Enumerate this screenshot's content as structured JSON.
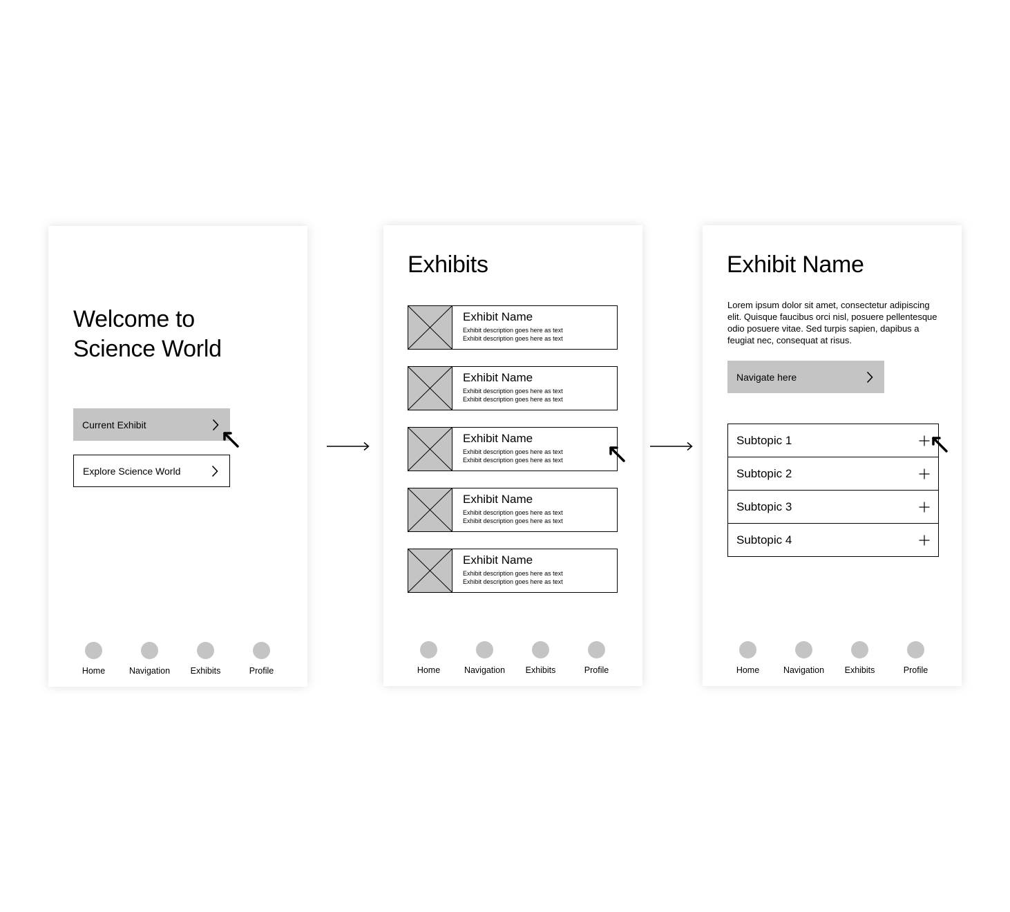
{
  "welcome": {
    "heading_line1": "Welcome to",
    "heading_line2": "Science World",
    "current_exhibit_label": "Current Exhibit",
    "explore_label": "Explore Science World"
  },
  "exhibits": {
    "title": "Exhibits",
    "items": [
      {
        "name": "Exhibit Name",
        "desc1": "Exhibit description goes here as text",
        "desc2": "Exhibit description goes here as text"
      },
      {
        "name": "Exhibit Name",
        "desc1": "Exhibit description goes here as text",
        "desc2": "Exhibit description goes here as text"
      },
      {
        "name": "Exhibit Name",
        "desc1": "Exhibit description goes here as text",
        "desc2": "Exhibit description goes here as text"
      },
      {
        "name": "Exhibit Name",
        "desc1": "Exhibit description goes here as text",
        "desc2": "Exhibit description goes here as text"
      },
      {
        "name": "Exhibit Name",
        "desc1": "Exhibit description goes here as text",
        "desc2": "Exhibit description goes here as text"
      }
    ]
  },
  "detail": {
    "title": "Exhibit Name",
    "body": "Lorem ipsum dolor sit amet, consectetur adipiscing elit. Quisque faucibus orci nisl, posuere pellentesque odio posuere vitae. Sed turpis sapien, dapibus a feugiat nec, consequat at risus.",
    "navigate_label": "Navigate here",
    "subtopics": [
      "Subtopic 1",
      "Subtopic 2",
      "Subtopic 3",
      "Subtopic 4"
    ]
  },
  "tabbar": {
    "tabs": [
      "Home",
      "Navigation",
      "Exhibits",
      "Profile"
    ]
  },
  "colors": {
    "placeholder_gray": "#c4c4c4",
    "stroke": "#000000",
    "background": "#ffffff"
  }
}
